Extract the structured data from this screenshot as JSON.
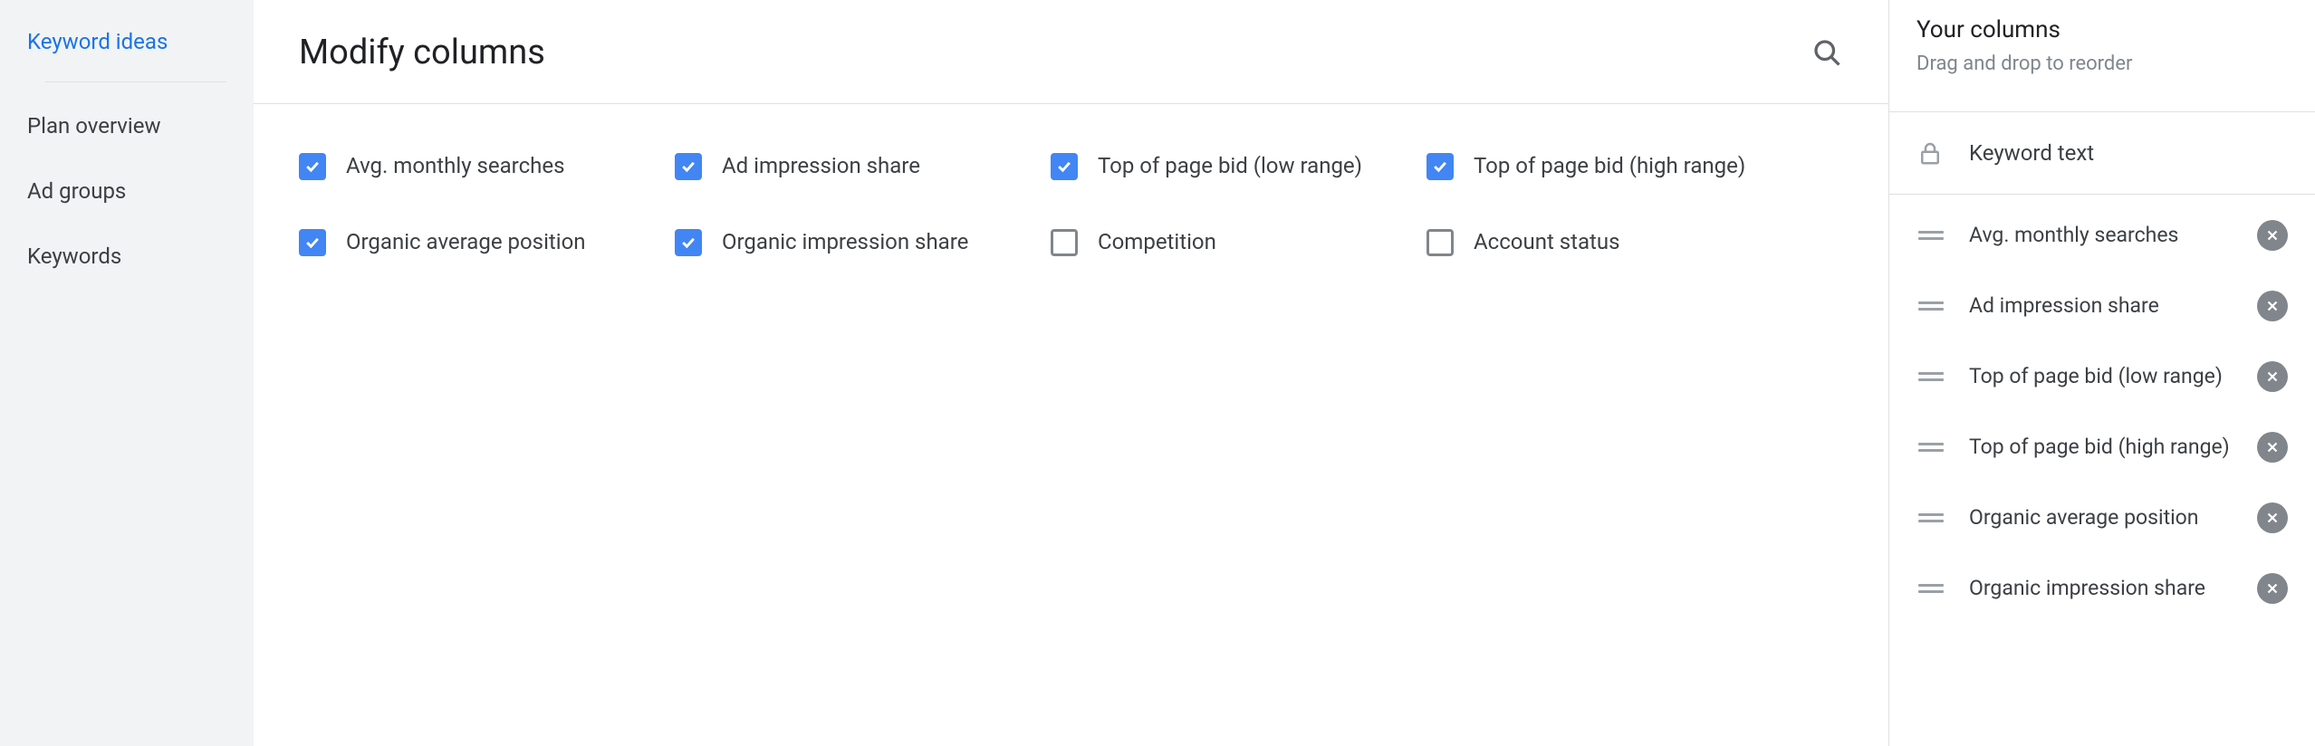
{
  "sidebar": {
    "items": [
      {
        "label": "Keyword ideas",
        "active": true
      },
      {
        "label": "Plan overview",
        "active": false
      },
      {
        "label": "Ad groups",
        "active": false
      },
      {
        "label": "Keywords",
        "active": false
      }
    ]
  },
  "main": {
    "title": "Modify columns",
    "options": [
      {
        "label": "Avg. monthly searches",
        "checked": true
      },
      {
        "label": "Ad impression share",
        "checked": true
      },
      {
        "label": "Top of page bid (low range)",
        "checked": true
      },
      {
        "label": "Top of page bid (high range)",
        "checked": true
      },
      {
        "label": "Organic average position",
        "checked": true
      },
      {
        "label": "Organic impression share",
        "checked": true
      },
      {
        "label": "Competition",
        "checked": false
      },
      {
        "label": "Account status",
        "checked": false
      }
    ]
  },
  "rightPanel": {
    "title": "Your columns",
    "subtitle": "Drag and drop to reorder",
    "locked": {
      "label": "Keyword text"
    },
    "items": [
      {
        "label": "Avg. monthly searches"
      },
      {
        "label": "Ad impression share"
      },
      {
        "label": "Top of page bid (low range)"
      },
      {
        "label": "Top of page bid (high range)"
      },
      {
        "label": "Organic average position"
      },
      {
        "label": "Organic impression share"
      }
    ]
  }
}
